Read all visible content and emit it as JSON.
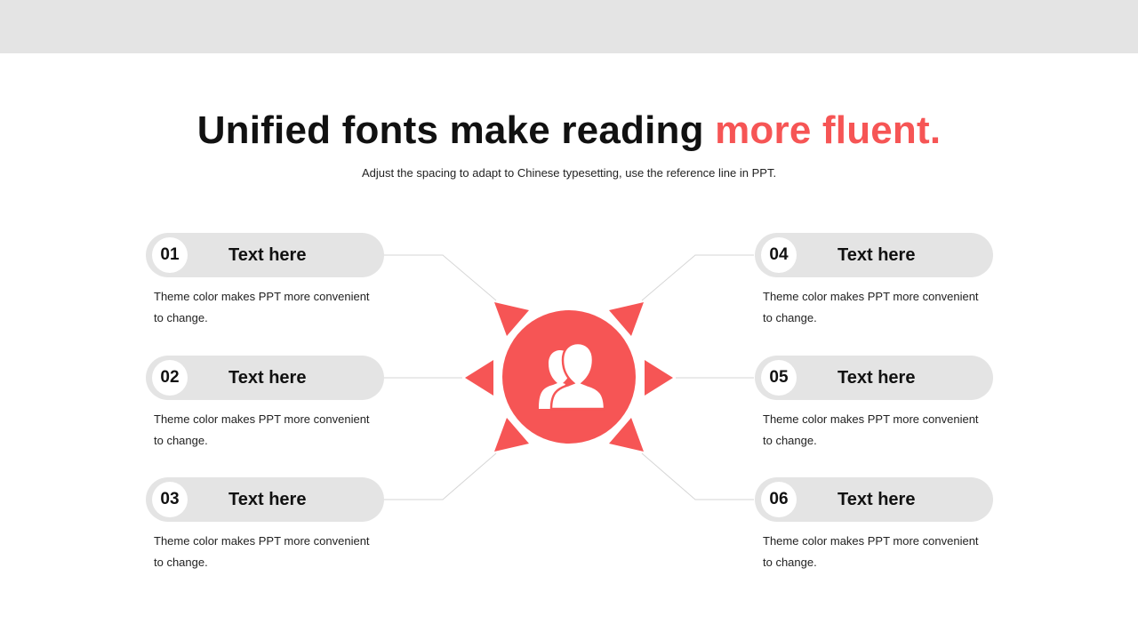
{
  "header": {
    "title_main": "Unified fonts make reading ",
    "title_accent": "more fluent.",
    "subtitle": "Adjust the spacing to adapt to Chinese typesetting, use the reference line in PPT."
  },
  "items": [
    {
      "number": "01",
      "title": "Text here",
      "description": "Theme color makes PPT more convenient to change."
    },
    {
      "number": "02",
      "title": "Text here",
      "description": "Theme color makes PPT more convenient to change."
    },
    {
      "number": "03",
      "title": "Text here",
      "description": "Theme color makes PPT more convenient to change."
    },
    {
      "number": "04",
      "title": "Text here",
      "description": "Theme color makes PPT more convenient to change."
    },
    {
      "number": "05",
      "title": "Text here",
      "description": "Theme color makes PPT more convenient to change."
    },
    {
      "number": "06",
      "title": "Text here",
      "description": "Theme color makes PPT more convenient to change."
    }
  ],
  "center": {
    "icon": "users-icon"
  },
  "colors": {
    "accent": "#f65555",
    "pill": "#e4e4e4",
    "topbar": "#e4e4e4"
  }
}
